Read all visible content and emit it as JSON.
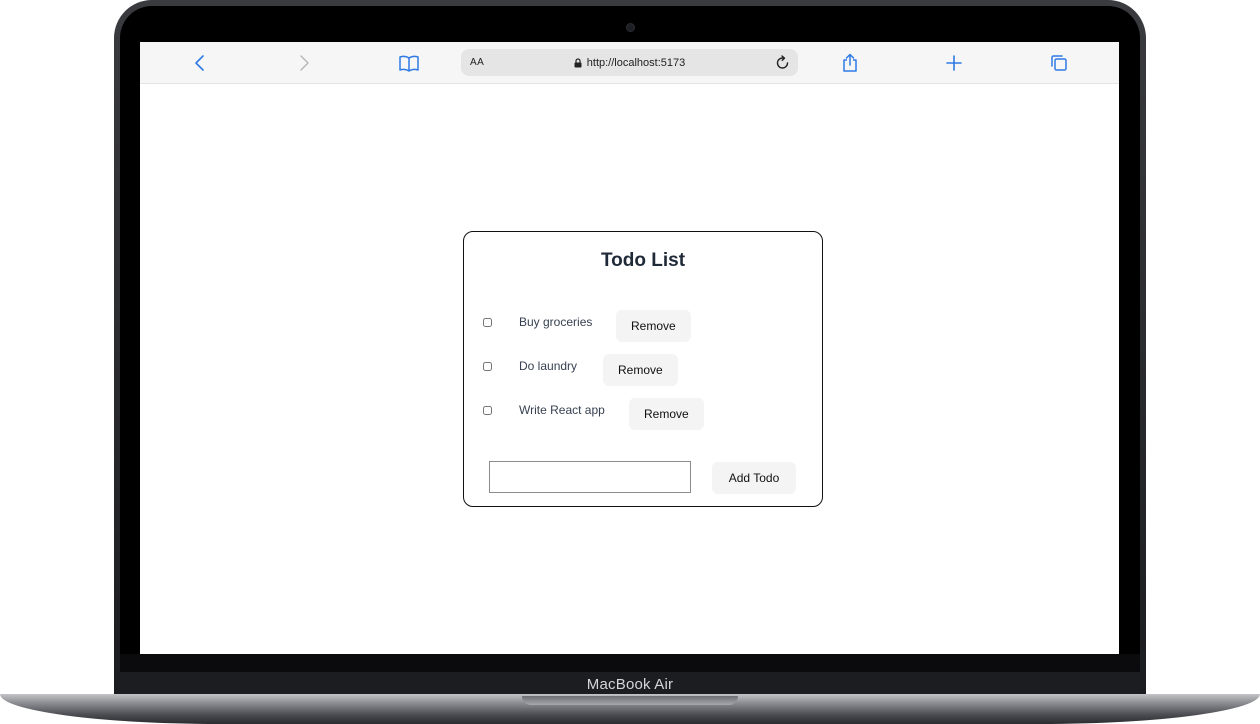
{
  "device": {
    "brand_label": "MacBook Air"
  },
  "browser": {
    "text_size_label": "AA",
    "url": "http://localhost:5173",
    "accent_color": "#2f7ae5",
    "icons": [
      "chevron-left-icon",
      "chevron-right-icon",
      "bookmarks-book-icon",
      "lock-icon",
      "reload-icon",
      "share-icon",
      "plus-icon",
      "tabs-icon"
    ]
  },
  "todo": {
    "title": "Todo List",
    "items": [
      {
        "text": "Buy groceries",
        "completed": false,
        "remove_label": "Remove"
      },
      {
        "text": "Do laundry",
        "completed": false,
        "remove_label": "Remove"
      },
      {
        "text": "Write React app",
        "completed": false,
        "remove_label": "Remove"
      }
    ],
    "new_todo_value": "",
    "add_button_label": "Add Todo"
  }
}
